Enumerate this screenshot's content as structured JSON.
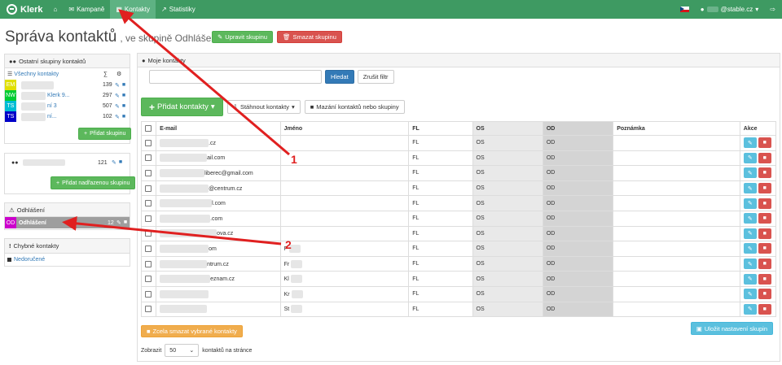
{
  "nav": {
    "brand": "Klerk",
    "items": [
      {
        "label": "Kampaně",
        "icon": "envelope-icon"
      },
      {
        "label": "Kontakty",
        "icon": "contacts-book-icon",
        "active": true
      },
      {
        "label": "Statistiky",
        "icon": "chart-icon"
      }
    ],
    "user": "@stable.cz"
  },
  "title": {
    "main": "Správa kontaktů",
    "sub": ", ve skupině Odhlášení",
    "edit_btn": "Upravit skupinu",
    "delete_btn": "Smazat skupinu"
  },
  "left": {
    "other_groups": {
      "title": "Ostatní skupiny kontaktů",
      "all_label": "Všechny kontakty",
      "sum_symbol": "∑",
      "rows": [
        {
          "tag": "EM",
          "color": "#e0e000",
          "name": "",
          "count": "139"
        },
        {
          "tag": "NW",
          "color": "#00cc33",
          "name": "Klerk 9...",
          "count": "297"
        },
        {
          "tag": "TS",
          "color": "#00bcd4",
          "name": "ní 3",
          "count": "507"
        },
        {
          "tag": "TS",
          "color": "#0000c8",
          "name": "ní...",
          "count": "102"
        }
      ],
      "add_btn": "Přidat skupinu"
    },
    "parent_group": {
      "count": "121",
      "add_btn": "Přidat nadřazenou skupinu"
    },
    "unsubscribed": {
      "title": "Odhlášení",
      "row": {
        "tag": "OD",
        "color": "#cc00cc",
        "name": "Odhlášení",
        "count": "12"
      }
    },
    "errors": {
      "title": "Chybné kontakty",
      "item": "Nedoručené"
    }
  },
  "main": {
    "title": "Moje kontakty",
    "search_btn": "Hledat",
    "reset_btn": "Zrušit filtr",
    "add_btn": "Přidat kontakty",
    "download_btn": "Stáhnout kontakty",
    "clear_btn": "Mazání kontaktů nebo skupiny",
    "columns": [
      "E-mail",
      "Jméno",
      "FL",
      "OS",
      "OD",
      "Poznámka",
      "Akce"
    ],
    "rows": [
      {
        "email": ".cz",
        "name": ""
      },
      {
        "email": "ail.com",
        "name": ""
      },
      {
        "email": "liberec@gmail.com",
        "name": ""
      },
      {
        "email": "@centrum.cz",
        "name": ""
      },
      {
        "email": "l.com",
        "name": ""
      },
      {
        "email": ".com",
        "name": ""
      },
      {
        "email": "ova.cz",
        "name": ""
      },
      {
        "email": "om",
        "name": "F"
      },
      {
        "email": "ntrum.cz",
        "name": "Fr"
      },
      {
        "email": "eznam.cz",
        "name": "Kl"
      },
      {
        "email": "",
        "name": "Kr"
      },
      {
        "email": "",
        "name": "St"
      }
    ],
    "fl_value": "FL",
    "os_value": "OS",
    "od_value": "OD",
    "bulk_delete_btn": "Zcela smazat vybrané kontakty",
    "save_btn": "Uložit nastavení skupin",
    "per_page_label_before": "Zobrazit",
    "per_page_value": "50",
    "per_page_label_after": "kontaktů na stránce"
  },
  "annotations": {
    "one": "1",
    "two": "2"
  }
}
